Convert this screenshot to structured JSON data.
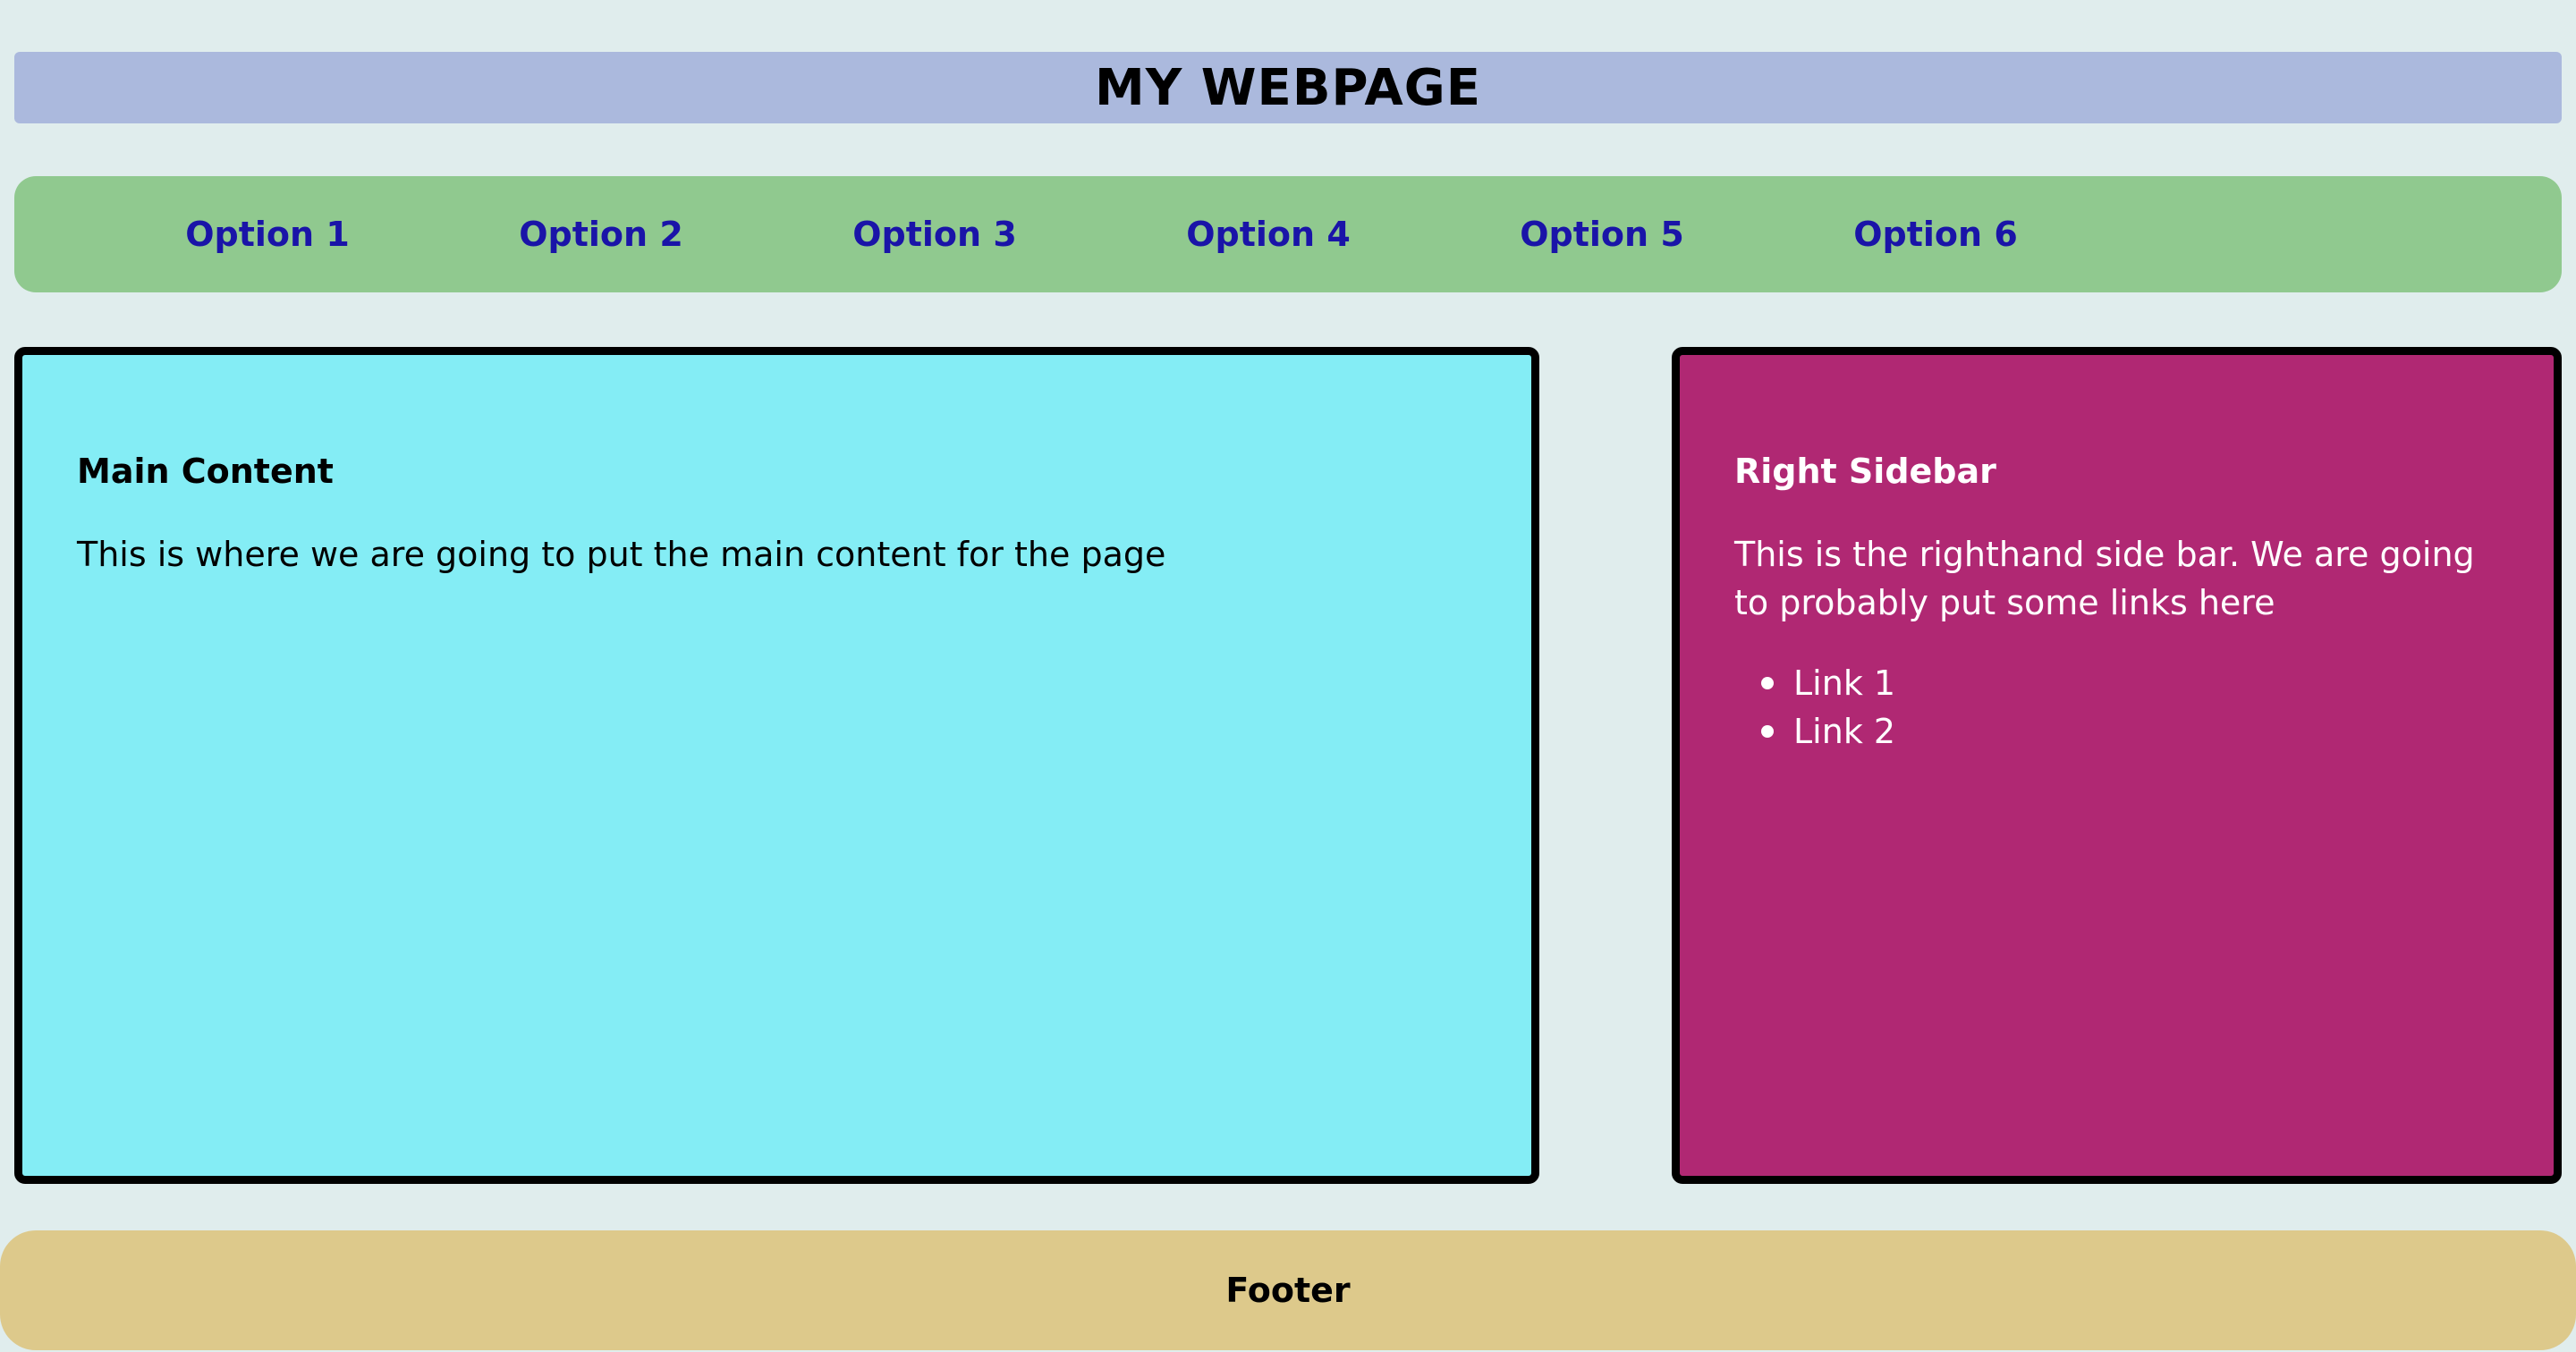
{
  "header": {
    "title": "MY WEBPAGE"
  },
  "nav": {
    "items": [
      {
        "label": "Option 1"
      },
      {
        "label": "Option 2"
      },
      {
        "label": "Option 3"
      },
      {
        "label": "Option 4"
      },
      {
        "label": "Option 5"
      },
      {
        "label": "Option 6"
      }
    ]
  },
  "main": {
    "heading": "Main Content",
    "text": "This is where we are going to put the main content for the page"
  },
  "sidebar": {
    "heading": "Right Sidebar",
    "text": "This is the righthand side bar. We are going to probably put some links here",
    "links": [
      {
        "label": "Link 1"
      },
      {
        "label": "Link 2"
      }
    ]
  },
  "footer": {
    "text": "Footer"
  },
  "colors": {
    "page_bg": "#e0eded",
    "header_bg": "#abb9dd",
    "nav_bg": "#90c98f",
    "nav_link": "#1a14a8",
    "main_bg": "#84edf5",
    "sidebar_bg": "#b02873",
    "footer_bg": "#ddc98b"
  }
}
